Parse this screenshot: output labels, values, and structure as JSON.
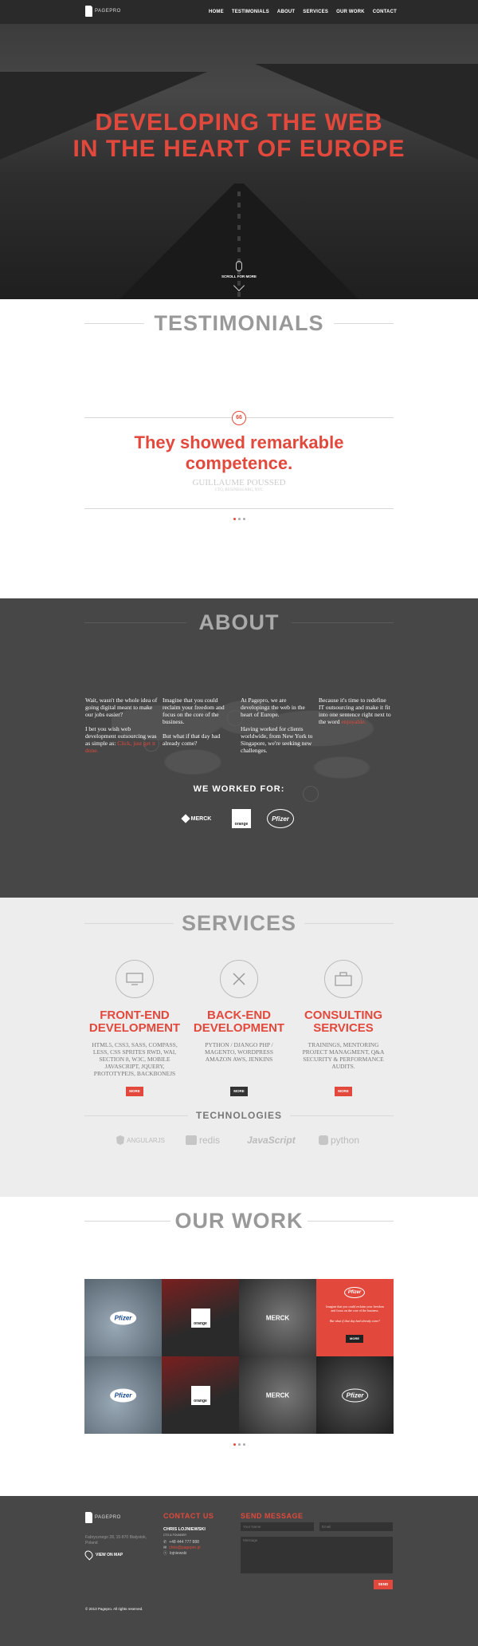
{
  "nav": {
    "logo_text": "PAGEPRO",
    "items": [
      "HOME",
      "TESTIMONIALS",
      "ABOUT",
      "SERVICES",
      "OUR WORK",
      "CONTACT"
    ]
  },
  "hero": {
    "title_line1": "DEVELOPING THE WEB",
    "title_line2": "IN THE HEART OF EUROPE",
    "scroll_label": "SCROLL FOR MORE"
  },
  "testimonials": {
    "title": "TESTIMONIALS",
    "quote_mark": "66",
    "quote_line1": "They showed remarkable",
    "quote_line2": "competence.",
    "name": "GUILLAUME POUSSED",
    "role": "CTO, BUSINESS ARC, NYC"
  },
  "about": {
    "title": "ABOUT",
    "col1_p1": "Wait, wasn't the whole idea of going digital meant to make our jobs easier?",
    "col1_p2a": "I bet you wish web development outsourcing was as simple as:",
    "col1_p2b": "Click, just get it done.",
    "col2_p1": "Imagine that you could reclaim your freedom and focus on the core of the business.",
    "col2_p2": "But what if that day had already come?",
    "col3_p1": "At Pagepro, we are developingz the web in the heart of Europe.",
    "col3_p2": "Having worked for clients worldwide, from New York to Singapore, we're seeking new challenges.",
    "col4_p1a": "Because it's time to redefine IT outsourcing and make it fit into one sentence right next to the word",
    "col4_p1b": "enjoyable.",
    "worked_title": "WE WORKED FOR:",
    "clients": [
      "MERCK",
      "orange",
      "Pfizer"
    ]
  },
  "services": {
    "title": "SERVICES",
    "items": [
      {
        "title1": "FRONT-END",
        "title2": "DEVELOPMENT",
        "desc": "HTML5, CSS3, SASS, COMPASS, LESS, CSS SPRITES RWD, WAI, SECTION 8, W3C, MOBILE JAVASCRIPT, JQUERY, PROTOTYPEJS, BACKBONEJS",
        "more": "MORE"
      },
      {
        "title1": "BACK-END",
        "title2": "DEVELOPMENT",
        "desc": "PYTHON / DJANGO PHP / MAGENTO, WORDPRESS AMAZON AWS, JENKINS",
        "more": "MORE"
      },
      {
        "title1": "CONSULTING",
        "title2": "SERVICES",
        "desc": "TRAININGS, MENTORING PROJECT MANAGMENT, Q&A SECURITY & PERFORMANCE AUDITS.",
        "more": "MORE"
      }
    ],
    "tech_title": "TECHNOLOGIES",
    "technologies": [
      "ANGULARJS",
      "redis",
      "JavaScript",
      "python"
    ]
  },
  "work": {
    "title": "OUR WORK",
    "tile_logos": [
      "Pfizer",
      "orange",
      "MERCK",
      "Pfizer",
      "Pfizer",
      "orange",
      "MERCK",
      "Pfizer"
    ],
    "overlay_text1": "Imagine that you could reclaim your freedom and focus on the core of the business.",
    "overlay_text2": "But what if that day had already come?",
    "overlay_more": "MORE"
  },
  "footer": {
    "logo_text": "PAGEPRO",
    "address": "Fabrycznego 28, 15-870 Bialystok, Poland",
    "map_link": "VIEW ON MAP",
    "contact_title": "CONTACT US",
    "person_name": "CHRIS LOJNIEWSKI",
    "person_role": "CTO & FOUNDER",
    "phone": "+48 444 777 888",
    "email": "chris@pagepro.pl",
    "skype": "lojniewski",
    "send_title": "SEND MESSAGE",
    "name_placeholder": "Your Name",
    "email_placeholder": "Email",
    "message_placeholder": "Message",
    "send_button": "SEND",
    "copyright": "© 2013 Pagepro. All rights reserved."
  },
  "colors": {
    "accent": "#e2493c",
    "dark": "#474747",
    "nav": "#2a2a2a",
    "light": "#ededed"
  }
}
